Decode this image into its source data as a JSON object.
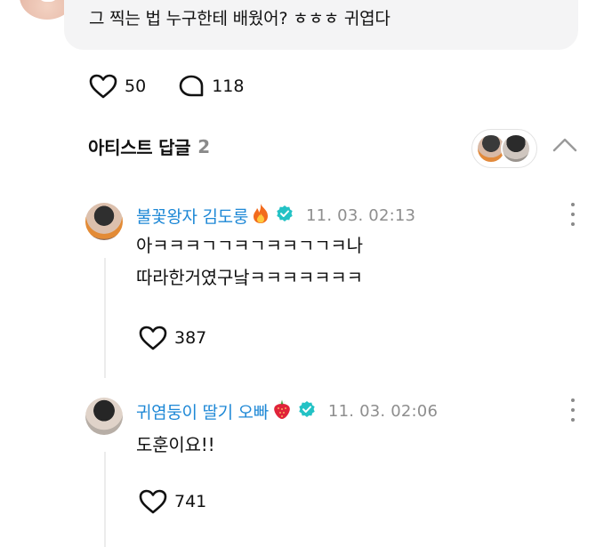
{
  "top_comment": {
    "text": "그 찍는 법 누구한테 배웠어? ㅎㅎㅎ 귀엽다",
    "likes": "50",
    "replies": "118"
  },
  "artist_replies": {
    "title": "아티스트 답글",
    "count": "2"
  },
  "replies": [
    {
      "name": "불꽃왕자 김도룽",
      "emoji": "fire-emoji",
      "verified": true,
      "time": "11. 03. 02:13",
      "text": "아ㅋㅋㅋㄱㄱㅋㄱㅋㅋㄱㄱㅋ나\n따라한거였구낰ㅋㅋㅋㅋㅋㅋㅋ",
      "likes": "387"
    },
    {
      "name": "귀염둥이 딸기 오빠",
      "emoji": "strawberry-emoji",
      "verified": true,
      "time": "11. 03. 02:06",
      "text": "도훈이요!!",
      "likes": "741"
    }
  ],
  "colors": {
    "accent_name": "#1e88d6",
    "verified": "#23c2c5",
    "muted": "#8e8e8e",
    "bubble_bg": "#f4f4f5"
  },
  "icons": [
    "heart-icon",
    "comment-icon",
    "verified-icon",
    "chevron-up-icon",
    "more-vertical-icon"
  ]
}
